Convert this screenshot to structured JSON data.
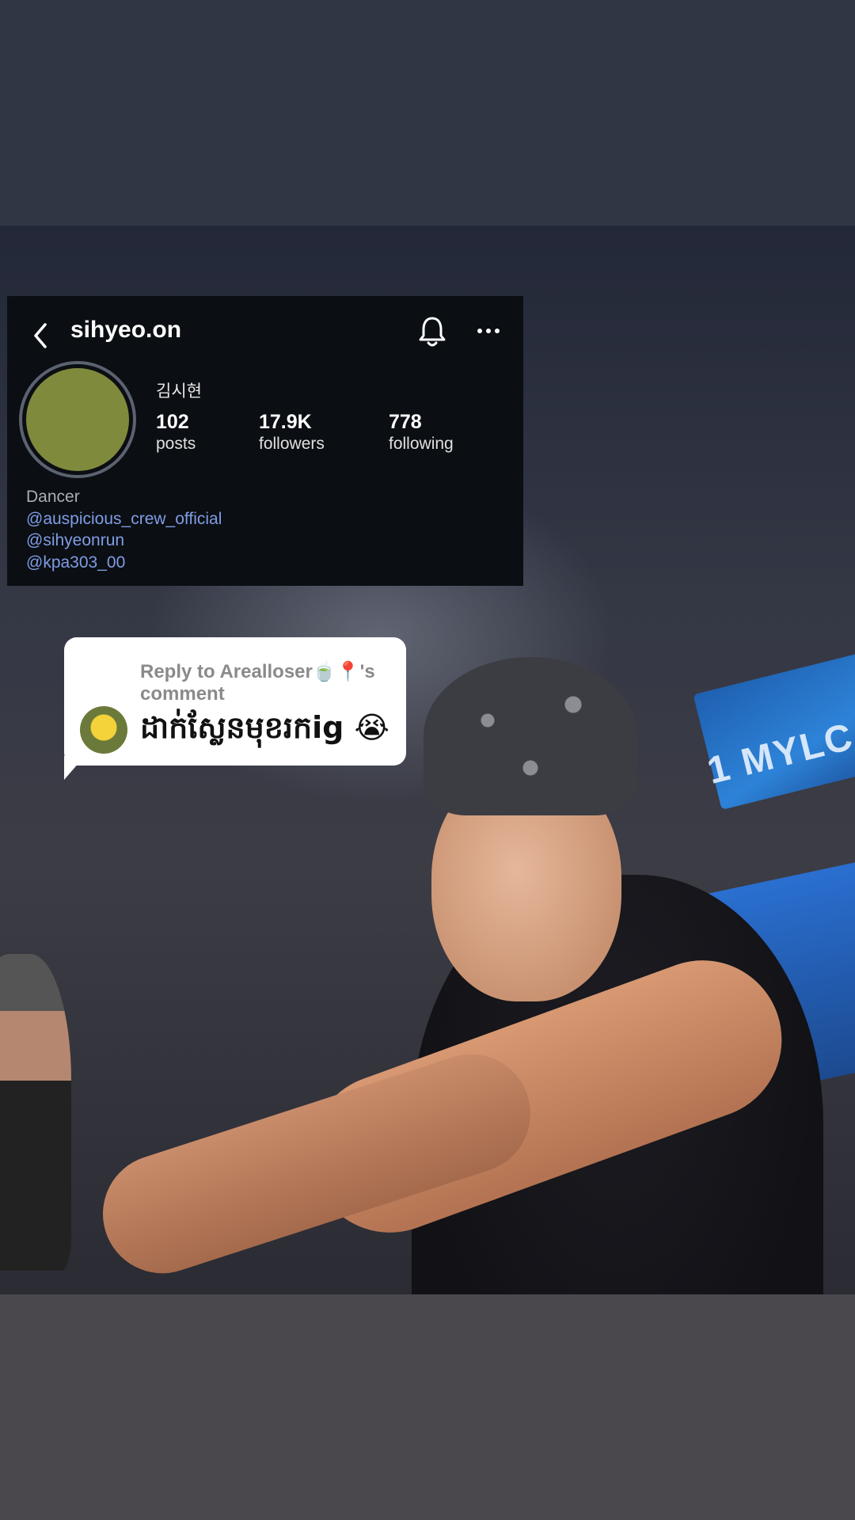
{
  "profile": {
    "handle": "sihyeo.on",
    "full_name": "김시현",
    "stats": [
      {
        "value": "102",
        "label": "posts"
      },
      {
        "value": "17.9K",
        "label": "followers"
      },
      {
        "value": "778",
        "label": "following"
      }
    ],
    "bio": {
      "role": "Dancer",
      "links": [
        "@auspicious_crew_official",
        "@sihyeonrun",
        "@kpa303_00"
      ]
    },
    "icons": {
      "back": "chevron-left-icon",
      "bell": "bell-icon",
      "more": "more-dots-icon"
    },
    "avatar_color": "#7f8a3c"
  },
  "reply": {
    "header": "Reply to Arealloser🍵📍's comment",
    "text": "ដាក់ស្លែនមុខរកig 😭"
  },
  "photo": {
    "stage_text": "1 MYLC"
  },
  "colors": {
    "card_bg": "#0b0e12",
    "link": "#7f9de6",
    "top_band": "#2f3644",
    "bottom_band": "#4a474d"
  }
}
